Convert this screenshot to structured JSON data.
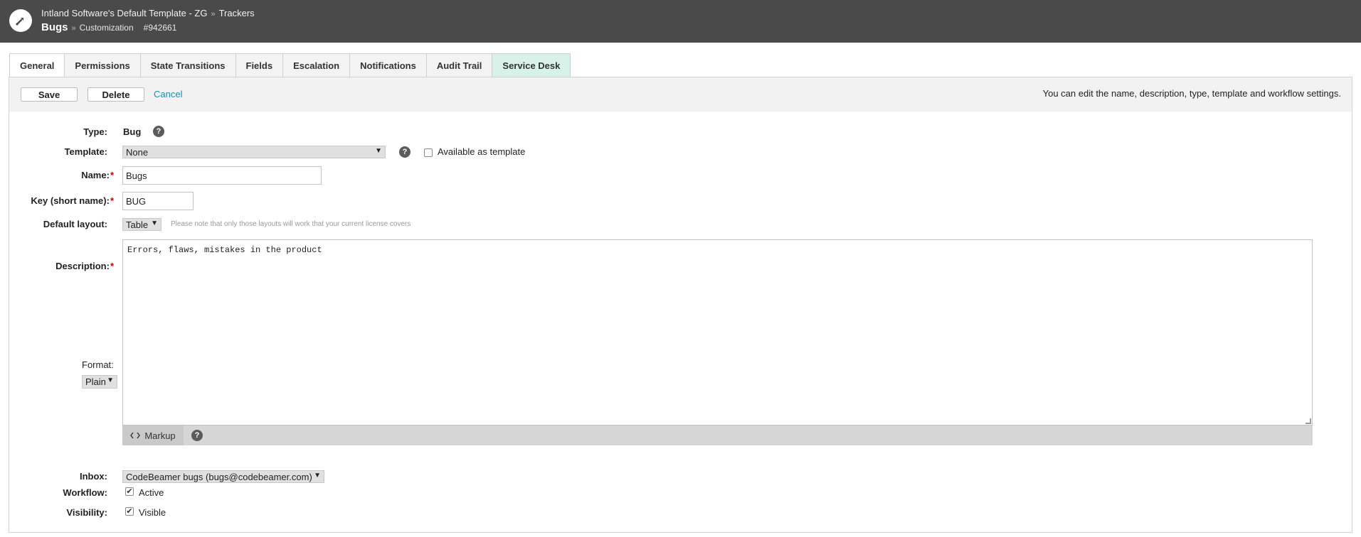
{
  "header": {
    "project": "Intland Software's Default Template - ZG",
    "separator": "»",
    "section": "Trackers",
    "title": "Bugs",
    "subtitle": "Customization",
    "item_id": "#942661"
  },
  "tabs": [
    {
      "label": "General",
      "active": true
    },
    {
      "label": "Permissions"
    },
    {
      "label": "State Transitions"
    },
    {
      "label": "Fields"
    },
    {
      "label": "Escalation"
    },
    {
      "label": "Notifications"
    },
    {
      "label": "Audit Trail"
    },
    {
      "label": "Service Desk"
    }
  ],
  "actions": {
    "save_label": "Save",
    "delete_label": "Delete",
    "cancel_label": "Cancel",
    "hint": "You can edit the name, description, type, template and workflow settings."
  },
  "form": {
    "type_label": "Type:",
    "type_value": "Bug",
    "template_label": "Template:",
    "template_value": "None",
    "available_template_label": "Available as template",
    "name_label": "Name:",
    "name_value": "Bugs",
    "key_label": "Key (short name):",
    "key_value": "BUG",
    "layout_label": "Default layout:",
    "layout_value": "Table",
    "layout_note": "Please note that only those layouts will work that your current license covers",
    "description_label": "Description:",
    "description_value": "Errors, flaws, mistakes in the product",
    "format_label": "Format:",
    "format_value": "Plain",
    "markup_label": "Markup",
    "inbox_label": "Inbox:",
    "inbox_value": "CodeBeamer bugs (bugs@codebeamer.com)",
    "workflow_label": "Workflow:",
    "workflow_value": "Active",
    "visibility_label": "Visibility:",
    "visibility_value": "Visible",
    "required_mark": "*",
    "help_glyph": "?",
    "check_glyph": "✔",
    "arrow_glyph": "▼"
  },
  "colors": {
    "header_bg": "#4a4a4a",
    "link": "#1b8bb3",
    "service_tab_bg": "#d8f2ea",
    "required": "#cc0000"
  }
}
